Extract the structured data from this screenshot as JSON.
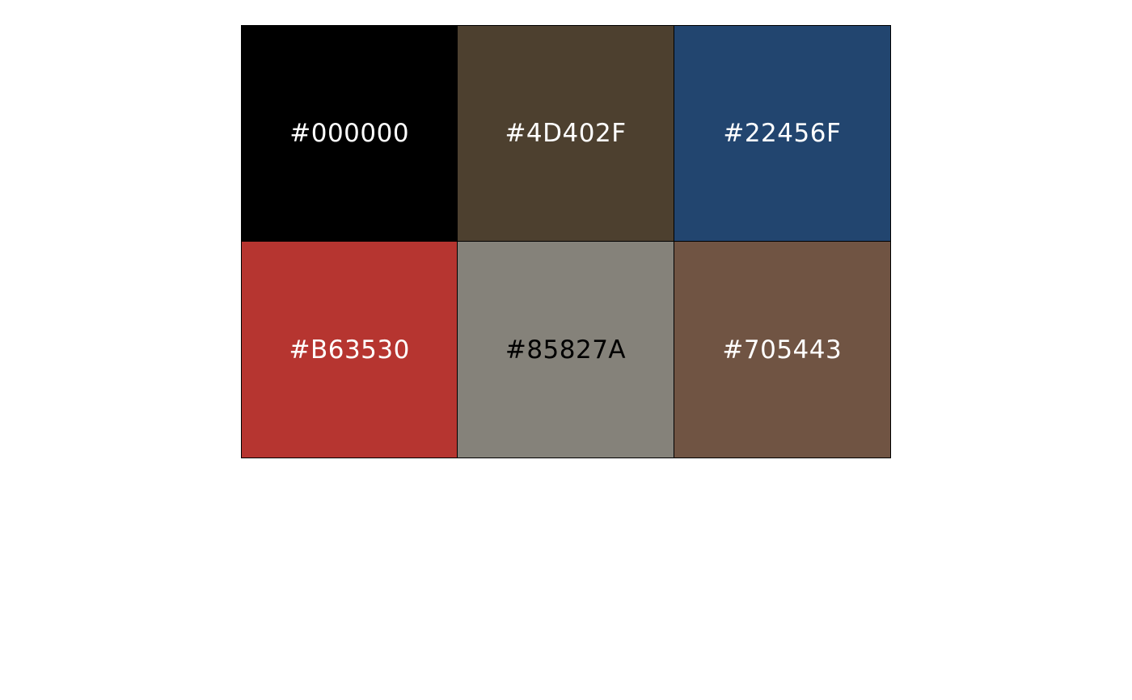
{
  "palette": {
    "swatches": [
      {
        "hex": "#000000",
        "label": "#000000",
        "text_color": "#FFFFFF"
      },
      {
        "hex": "#4D402F",
        "label": "#4D402F",
        "text_color": "#FFFFFF"
      },
      {
        "hex": "#22456F",
        "label": "#22456F",
        "text_color": "#FFFFFF"
      },
      {
        "hex": "#B63530",
        "label": "#B63530",
        "text_color": "#FFFFFF"
      },
      {
        "hex": "#85827A",
        "label": "#85827A",
        "text_color": "#000000"
      },
      {
        "hex": "#705443",
        "label": "#705443",
        "text_color": "#FFFFFF"
      }
    ]
  }
}
